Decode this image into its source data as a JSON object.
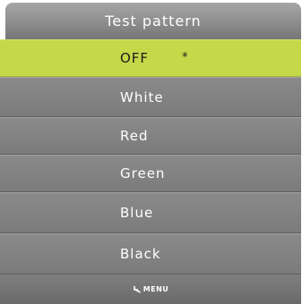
{
  "menu": {
    "title": "Test pattern",
    "items": [
      {
        "label": "OFF",
        "marker": "*",
        "selected": true
      },
      {
        "label": "White"
      },
      {
        "label": "Red"
      },
      {
        "label": "Green"
      },
      {
        "label": "Blue"
      },
      {
        "label": "Black"
      }
    ]
  },
  "footer": {
    "hint_icon": "return-arrow-icon",
    "hint_label": "MENU"
  },
  "colors": {
    "highlight": "#c4d849",
    "item_background": "#808080",
    "title_background": "#8f8f8f"
  }
}
